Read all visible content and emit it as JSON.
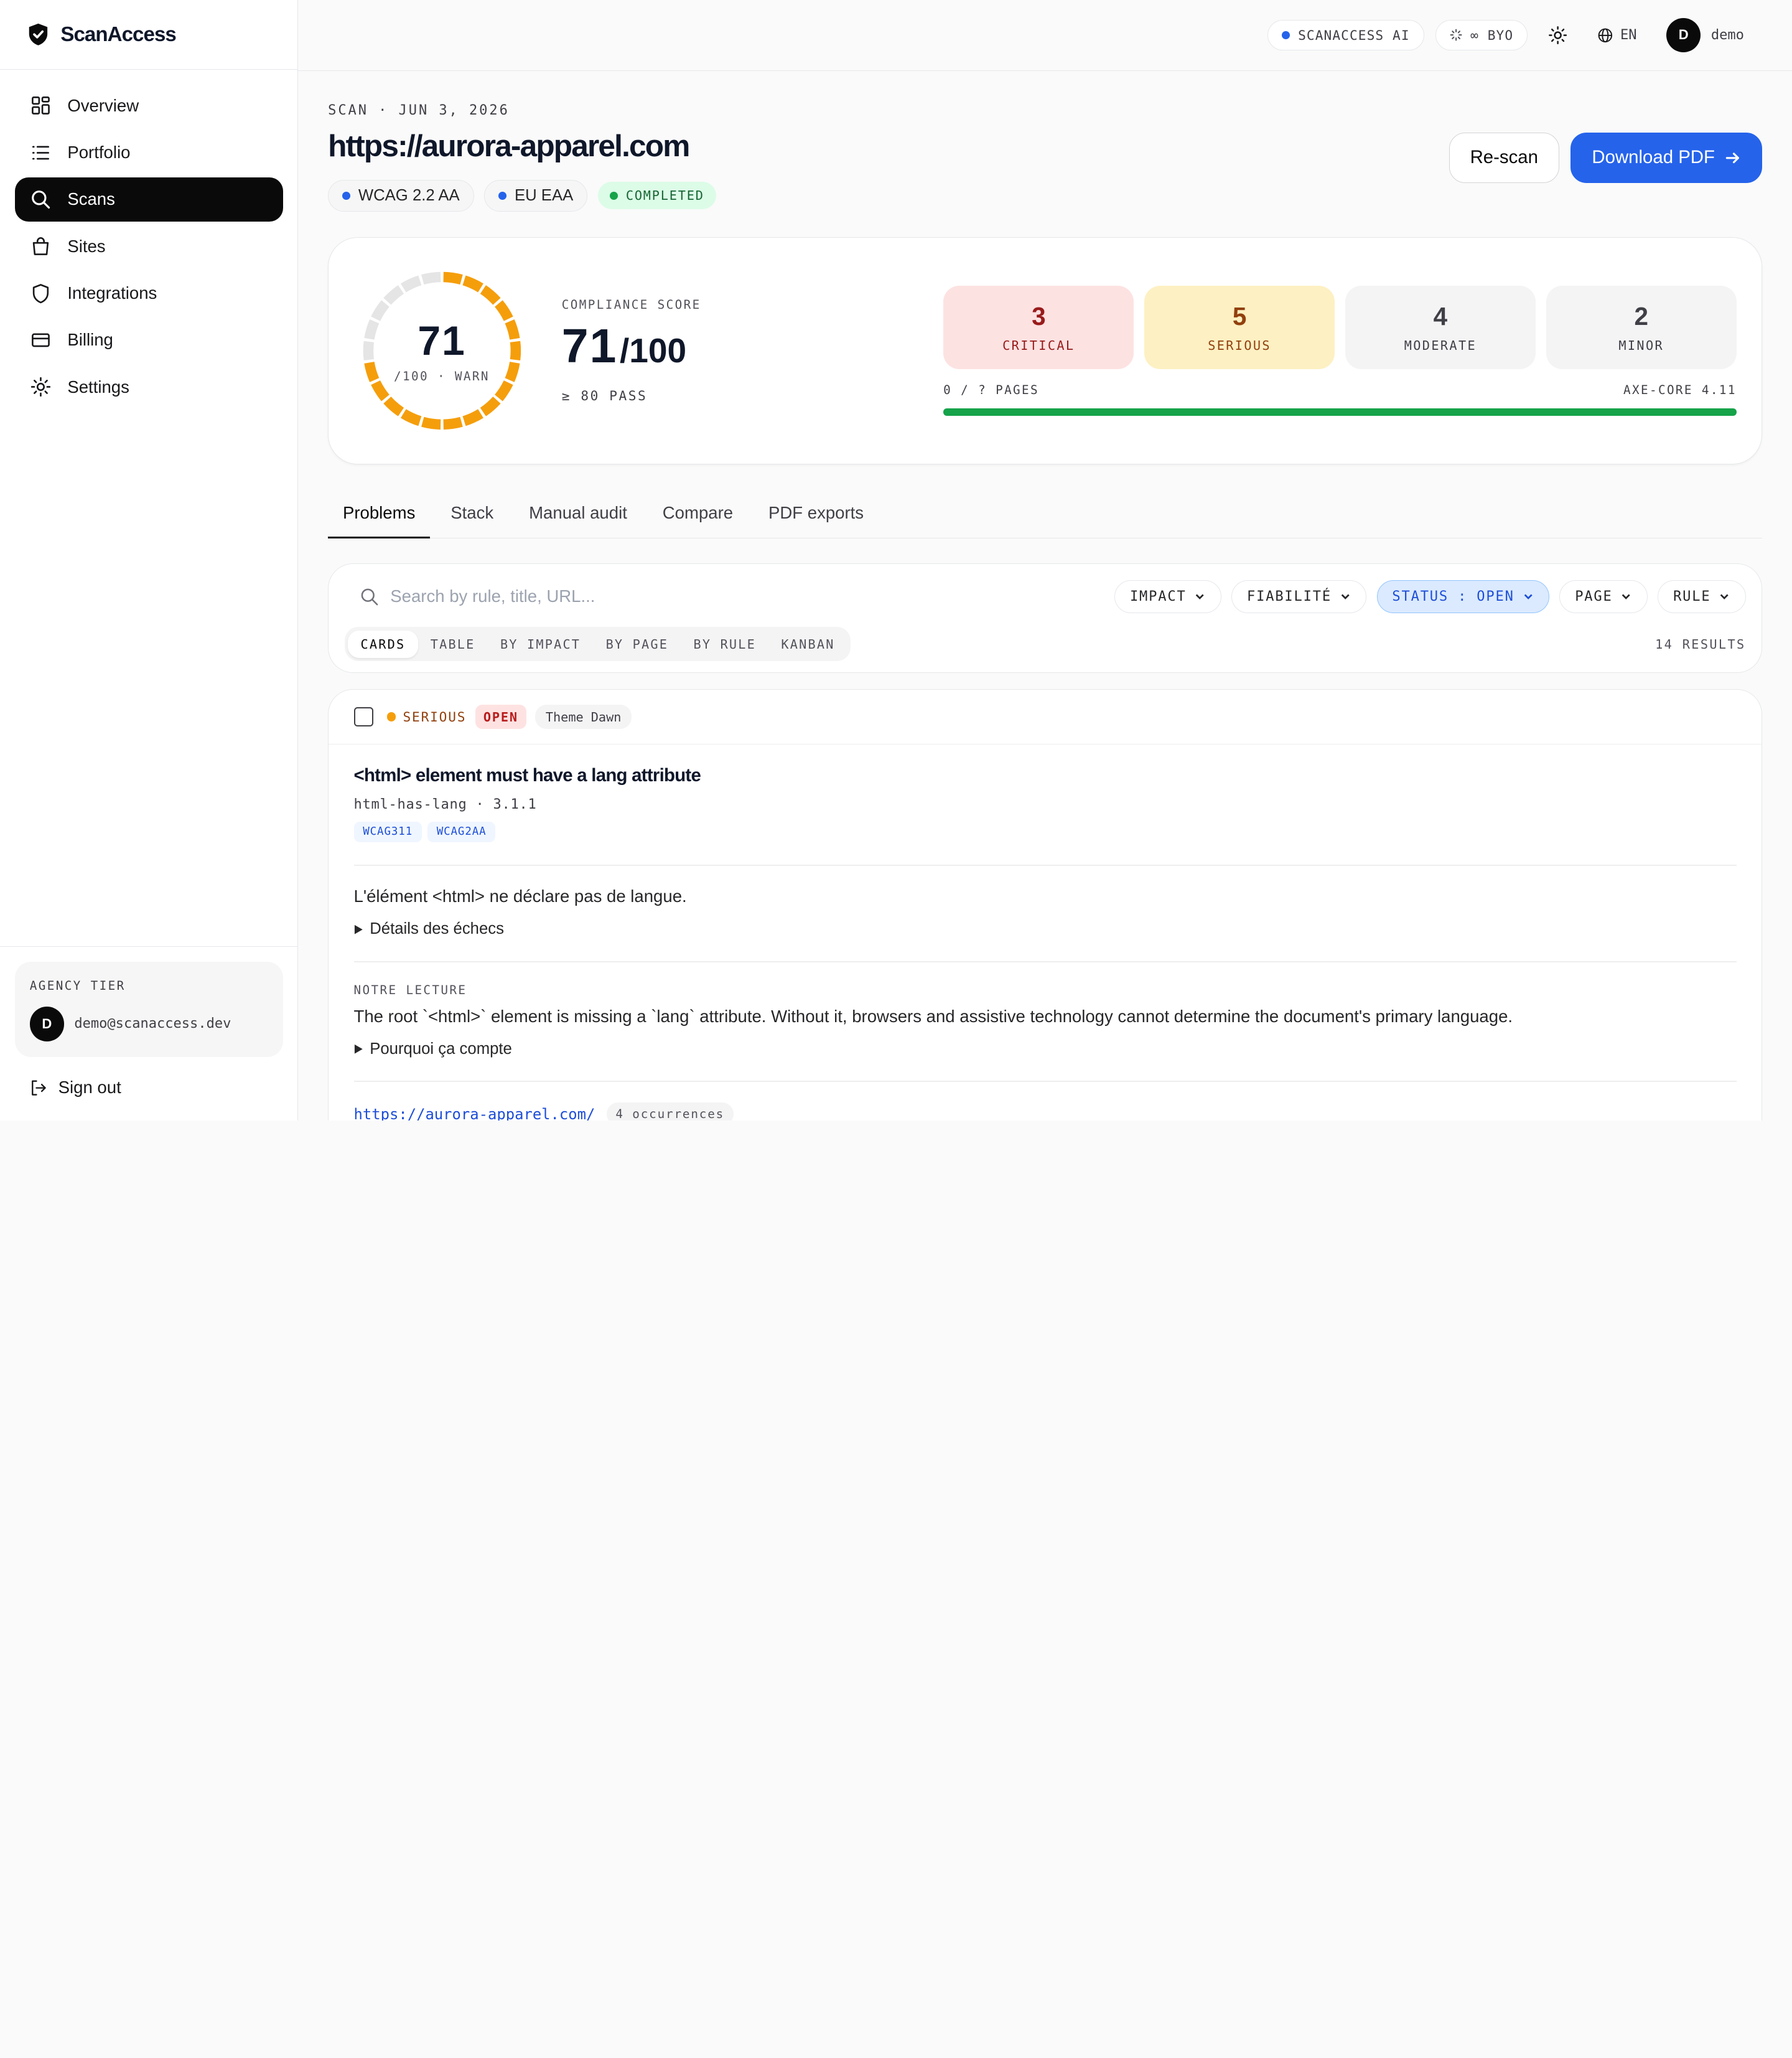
{
  "brand": {
    "name": "ScanAccess"
  },
  "sidebar": {
    "items": [
      {
        "label": "Overview",
        "icon": "grid-icon"
      },
      {
        "label": "Portfolio",
        "icon": "list-icon"
      },
      {
        "label": "Scans",
        "icon": "search-icon",
        "active": true
      },
      {
        "label": "Sites",
        "icon": "bag-icon"
      },
      {
        "label": "Integrations",
        "icon": "shield-icon"
      },
      {
        "label": "Billing",
        "icon": "card-icon"
      },
      {
        "label": "Settings",
        "icon": "gear-icon"
      }
    ],
    "tier_label": "AGENCY TIER",
    "user_initial": "D",
    "user_email": "demo@scanaccess.dev",
    "signout": "Sign out"
  },
  "topbar": {
    "ai_label": "SCANACCESS AI",
    "byo_label": "∞ BYO",
    "lang": "EN",
    "user_initial": "D",
    "user_name": "demo"
  },
  "scan": {
    "eyebrow": "SCAN · JUN 3, 2026",
    "url": "https://aurora-apparel.com",
    "tags": [
      "WCAG 2.2 AA",
      "EU EAA"
    ],
    "status": "COMPLETED",
    "rescan": "Re-scan",
    "download": "Download PDF"
  },
  "score": {
    "value": "71",
    "gauge_sub": "/100 · WARN",
    "label": "COMPLIANCE SCORE",
    "big": "71",
    "denom": "/100",
    "pass": "≥ 80 PASS",
    "fraction": 0.71
  },
  "severity": {
    "items": [
      {
        "count": "3",
        "label": "CRITICAL",
        "bg": "#fde2e2",
        "fg": "#991b1b"
      },
      {
        "count": "5",
        "label": "SERIOUS",
        "bg": "#fdf0c2",
        "fg": "#92400e"
      },
      {
        "count": "4",
        "label": "MODERATE",
        "bg": "#f4f4f5",
        "fg": "#3f3f46"
      },
      {
        "count": "2",
        "label": "MINOR",
        "bg": "#f4f4f5",
        "fg": "#3f3f46"
      }
    ],
    "pages": "0 / ? PAGES",
    "engine": "AXE-CORE 4.11",
    "progress": 1.0
  },
  "tabs": [
    "Problems",
    "Stack",
    "Manual audit",
    "Compare",
    "PDF exports"
  ],
  "filters": {
    "placeholder": "Search by rule, title, URL...",
    "chips": [
      "IMPACT",
      "FIABILITÉ",
      "STATUS : OPEN",
      "PAGE",
      "RULE"
    ],
    "views": [
      "CARDS",
      "TABLE",
      "BY IMPACT",
      "BY PAGE",
      "BY RULE",
      "KANBAN"
    ],
    "results": "14 RESULTS"
  },
  "issue": {
    "severity": "SERIOUS",
    "status": "OPEN",
    "theme": "Theme Dawn",
    "title": "<html> element must have a lang attribute",
    "rule": "html-has-lang · 3.1.1",
    "wcag": [
      "WCAG311",
      "WCAG2AA"
    ],
    "description": "L'élément <html> ne déclare pas de langue.",
    "details": "Détails des échecs",
    "reading_label": "NOTRE LECTURE",
    "reading": "The root `<html>` element is missing a `lang` attribute. Without it, browsers and assistive technology cannot determine the document's primary language.",
    "why": "Pourquoi ça compte",
    "occ_url": "https://aurora-apparel.com/",
    "occ_count": "4 occurrences"
  },
  "colors": {
    "accent": "#2563eb",
    "warn": "#f59e0b",
    "pass": "#16a34a"
  }
}
